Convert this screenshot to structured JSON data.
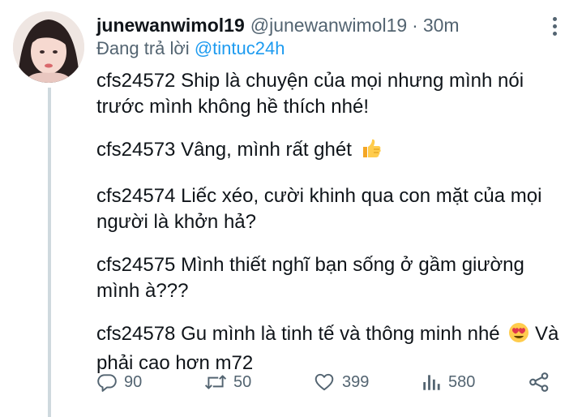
{
  "tweet": {
    "author": {
      "display_name": "junewanwimol19",
      "handle": "@junewanwimol19",
      "avatar_icon": "profile-photo"
    },
    "separator": "·",
    "time": "30m",
    "reply_prefix": "Đang trả lời",
    "reply_to": "@tintuc24h",
    "paragraphs": [
      {
        "text": "cfs24572 Ship là chuyện của mọi nhưng mình nói trước mình không hề thích nhé!",
        "emoji": ""
      },
      {
        "text": "cfs24573 Vâng, mình rất ghét",
        "emoji": "thumbs-up"
      },
      {
        "text": "cfs24574 Liếc xéo, cười khinh qua con mặt của mọi người là khởn hả?",
        "emoji": ""
      },
      {
        "text": "cfs24575 Mình thiết nghĩ bạn sống ở gầm giường mình à???",
        "emoji": ""
      },
      {
        "text_before": "cfs24578 Gu mình là tinh tế và thông minh nhé",
        "emoji": "heart-eyes",
        "text_after": "Và phải cao hơn m72"
      }
    ],
    "actions": {
      "reply": {
        "icon": "reply-icon",
        "count": "90"
      },
      "retweet": {
        "icon": "retweet-icon",
        "count": "50"
      },
      "like": {
        "icon": "heart-icon",
        "count": "399"
      },
      "views": {
        "icon": "analytics-icon",
        "count": "580"
      },
      "share": {
        "icon": "share-icon"
      }
    },
    "colors": {
      "text": "#0f1419",
      "secondary": "#536471",
      "link": "#1d9bf0",
      "thread_line": "#cfd9de"
    }
  }
}
